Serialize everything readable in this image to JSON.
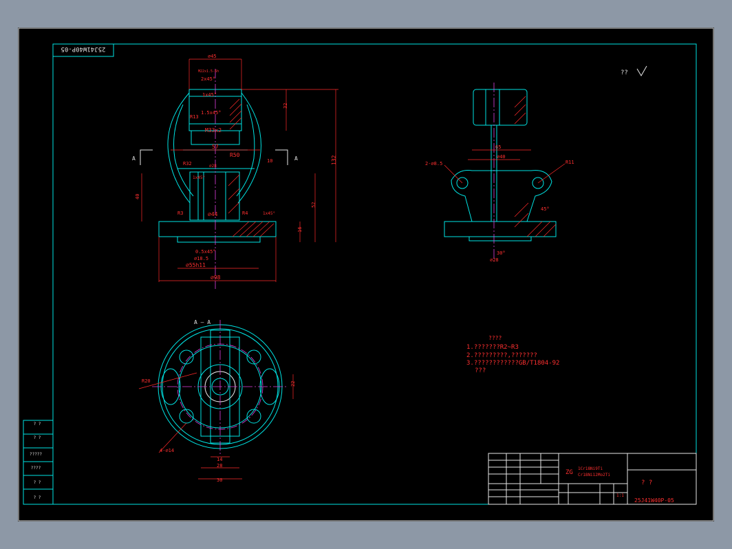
{
  "drawing": {
    "number_box": "25J41W40P-05",
    "roughness_note": "?? ",
    "notes": {
      "title": "????",
      "lines": [
        "1.???????R2~R3",
        "2.?????????,???????",
        "3.????????????GB/T1804-92",
        "???"
      ]
    },
    "material_code": "ZG",
    "material_lines": [
      "1Cr18Ni9Ti",
      "Cr18Ni12Mo2Ti"
    ],
    "title_block_name": "?    ?",
    "title_block_number": "25J41W40P-05",
    "scale": "1:1",
    "side_labels": [
      "?  ?",
      "?  ?",
      "?????",
      "????",
      "?  ?",
      "?  ?"
    ],
    "section_label_left": "A",
    "section_label_right": "A",
    "section_ref": "A — A"
  },
  "dimensions": {
    "phi45": "⌀45",
    "m22": "M22x1.5-6h",
    "c1": "2x45°",
    "c2": "1x45°",
    "c3": "1.5x45°",
    "r13": "R13",
    "m33": "M33x2",
    "d57": "57",
    "r50": "R50",
    "r32": "R32",
    "phi28": "⌀28",
    "d10": "10",
    "c4": "1x45°",
    "d40": "40",
    "phi44": "⌀44",
    "r3": "R3",
    "r4": "R4",
    "c5": "1x45°",
    "d52": "52",
    "d16": "16",
    "d132": "132",
    "d32": "32",
    "c6": "0.5x45°",
    "phi185": "⌀18.5",
    "phi55": "⌀55h11",
    "phi98": "⌀98",
    "d65": "65",
    "d40b": "⌀40",
    "hole1": "2-⌀8.5",
    "r11": "R11",
    "a45": "45°",
    "a30": "30°",
    "phi28b": "⌀28",
    "r20": "R20",
    "d22": "22",
    "d14": "14",
    "d28": "28",
    "d30": "30",
    "hole2": "4-⌀14"
  }
}
